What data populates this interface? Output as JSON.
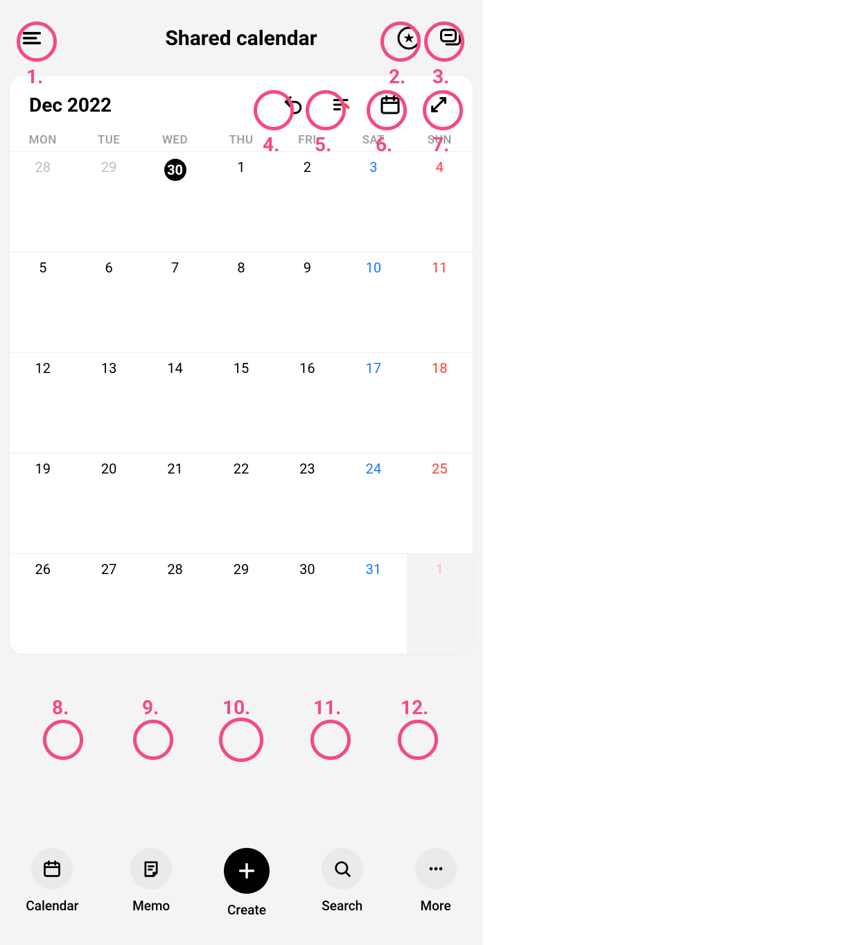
{
  "header": {
    "title": "Shared calendar"
  },
  "annotations": {
    "a1": "1.",
    "a2": "2.",
    "a3": "3.",
    "a4": "4.",
    "a5": "5.",
    "a6": "6.",
    "a7": "7.",
    "a8": "8.",
    "a9": "9.",
    "a10": "10.",
    "a11": "11.",
    "a12": "12."
  },
  "calendar": {
    "month_label": "Dec 2022",
    "dow": [
      "MON",
      "TUE",
      "WED",
      "THU",
      "FRI",
      "SAT",
      "SUN"
    ],
    "cells": [
      {
        "n": "28",
        "cls": "other-month"
      },
      {
        "n": "29",
        "cls": "other-month"
      },
      {
        "n": "30",
        "cls": "today"
      },
      {
        "n": "1",
        "cls": ""
      },
      {
        "n": "2",
        "cls": ""
      },
      {
        "n": "3",
        "cls": "sat"
      },
      {
        "n": "4",
        "cls": "sun"
      },
      {
        "n": "5",
        "cls": ""
      },
      {
        "n": "6",
        "cls": ""
      },
      {
        "n": "7",
        "cls": ""
      },
      {
        "n": "8",
        "cls": ""
      },
      {
        "n": "9",
        "cls": ""
      },
      {
        "n": "10",
        "cls": "sat"
      },
      {
        "n": "11",
        "cls": "sun"
      },
      {
        "n": "12",
        "cls": ""
      },
      {
        "n": "13",
        "cls": ""
      },
      {
        "n": "14",
        "cls": ""
      },
      {
        "n": "15",
        "cls": ""
      },
      {
        "n": "16",
        "cls": ""
      },
      {
        "n": "17",
        "cls": "sat"
      },
      {
        "n": "18",
        "cls": "sun"
      },
      {
        "n": "19",
        "cls": ""
      },
      {
        "n": "20",
        "cls": ""
      },
      {
        "n": "21",
        "cls": ""
      },
      {
        "n": "22",
        "cls": ""
      },
      {
        "n": "23",
        "cls": ""
      },
      {
        "n": "24",
        "cls": "sat"
      },
      {
        "n": "25",
        "cls": "sun"
      },
      {
        "n": "26",
        "cls": ""
      },
      {
        "n": "27",
        "cls": ""
      },
      {
        "n": "28",
        "cls": ""
      },
      {
        "n": "29",
        "cls": ""
      },
      {
        "n": "30",
        "cls": ""
      },
      {
        "n": "31",
        "cls": "sat"
      },
      {
        "n": "1",
        "cls": "other-month sun next-shade"
      }
    ]
  },
  "nav": {
    "calendar": "Calendar",
    "memo": "Memo",
    "create": "Create",
    "search": "Search",
    "more": "More"
  }
}
